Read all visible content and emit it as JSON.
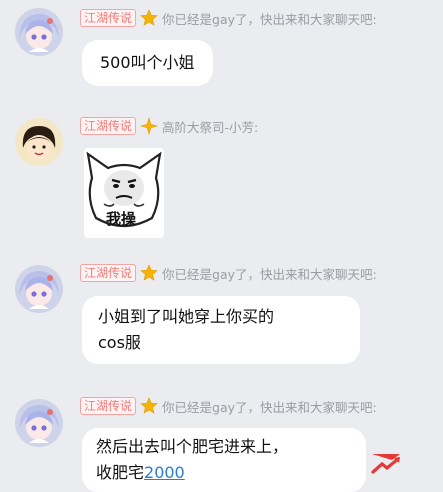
{
  "messages": [
    {
      "badge": "江湖传说",
      "nickname": "你已经是gay了，快出来和大家聊天吧:",
      "text": "500叫个小姐",
      "avatar": "anime-girl-avatar"
    },
    {
      "badge": "江湖传说",
      "nickname": "高阶大祭司-小芳:",
      "sticker_text": "我操",
      "avatar": "cartoon-girl-avatar"
    },
    {
      "badge": "江湖传说",
      "nickname": "你已经是gay了，快出来和大家聊天吧:",
      "line1": "小姐到了叫她穿上你买的",
      "line2": "cos服",
      "avatar": "anime-girl-avatar"
    },
    {
      "badge": "江湖传说",
      "nickname": "你已经是gay了，快出来和大家聊天吧:",
      "line1": "然后出去叫个肥宅进来上，",
      "line2_prefix": "收肥宅",
      "line2_link": "2000",
      "avatar": "anime-girl-avatar"
    }
  ],
  "colors": {
    "background": "#ebecef",
    "badge": "#f37b7b",
    "link": "#2b7bd6"
  }
}
